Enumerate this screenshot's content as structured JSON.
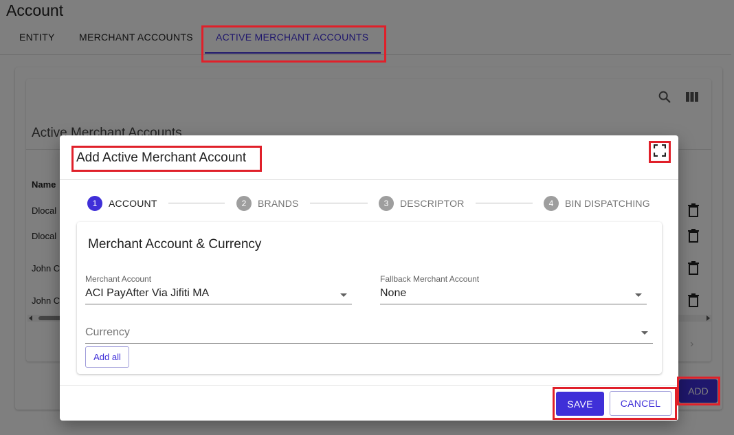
{
  "page": {
    "title": "Account",
    "tabs": [
      {
        "label": "ENTITY"
      },
      {
        "label": "MERCHANT ACCOUNTS"
      },
      {
        "label": "ACTIVE MERCHANT ACCOUNTS",
        "active": true
      }
    ]
  },
  "table": {
    "title": "Active Merchant Accounts",
    "column_header": "Name",
    "rows": [
      {
        "name": "Dlocal"
      },
      {
        "name": "Dlocal"
      },
      {
        "name": "John C"
      },
      {
        "name": "John C"
      }
    ],
    "add_label": "ADD",
    "toolbar_icons": [
      "search-icon",
      "view-column-icon"
    ]
  },
  "dialog": {
    "title": "Add Active Merchant Account",
    "steps": [
      {
        "num": "1",
        "label": "ACCOUNT",
        "active": true
      },
      {
        "num": "2",
        "label": "BRANDS"
      },
      {
        "num": "3",
        "label": "DESCRIPTOR"
      },
      {
        "num": "4",
        "label": "BIN DISPATCHING"
      }
    ],
    "section_title": "Merchant Account & Currency",
    "merchant_account": {
      "label": "Merchant Account",
      "value": "ACI PayAfter Via Jifiti MA"
    },
    "fallback_merchant_account": {
      "label": "Fallback Merchant Account",
      "value": "None"
    },
    "currency": {
      "placeholder": "Currency"
    },
    "add_all_label": "Add all",
    "save_label": "SAVE",
    "cancel_label": "CANCEL"
  },
  "colors": {
    "primary": "#3f2fd8",
    "highlight": "#e0202a",
    "step_inactive": "#9e9e9e"
  }
}
